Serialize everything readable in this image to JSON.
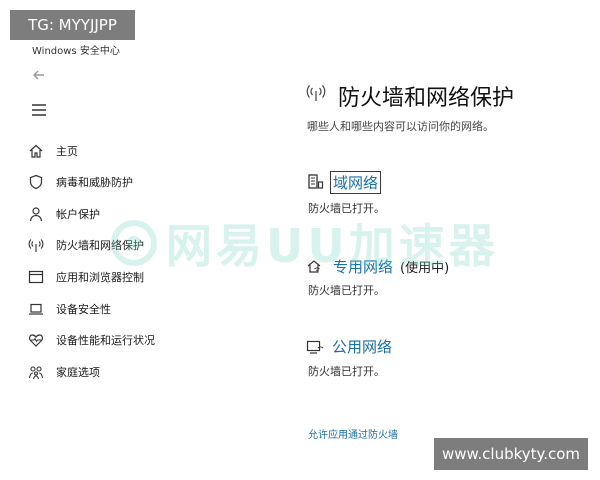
{
  "overlay": {
    "tg_badge": "TG: MYYJJPP",
    "site_badge": "www.clubkyty.com",
    "watermark_text": "网易UU加速器"
  },
  "window": {
    "title": "Windows 安全中心"
  },
  "sidebar": {
    "items": [
      {
        "label": "主页",
        "icon": "home-icon"
      },
      {
        "label": "病毒和威胁防护",
        "icon": "shield-icon"
      },
      {
        "label": "帐户保护",
        "icon": "person-icon"
      },
      {
        "label": "防火墙和网络保护",
        "icon": "wifi-antenna-icon"
      },
      {
        "label": "应用和浏览器控制",
        "icon": "app-window-icon"
      },
      {
        "label": "设备安全性",
        "icon": "laptop-icon"
      },
      {
        "label": "设备性能和运行状况",
        "icon": "heart-pulse-icon"
      },
      {
        "label": "家庭选项",
        "icon": "family-icon"
      }
    ]
  },
  "main": {
    "title": "防火墙和网络保护",
    "subtitle": "哪些人和哪些内容可以访问你的网络。",
    "networks": [
      {
        "name": "域网络",
        "status": "防火墙已打开。",
        "active": "",
        "icon": "domain-network-icon"
      },
      {
        "name": "专用网络",
        "status": "防火墙已打开。",
        "active": "(使用中)",
        "icon": "private-network-icon"
      },
      {
        "name": "公用网络",
        "status": "防火墙已打开。",
        "active": "",
        "icon": "public-network-icon"
      }
    ],
    "allow_app_link": "允许应用通过防火墙"
  },
  "colors": {
    "link": "#1a6fa8",
    "watermark": "#7fd6c8",
    "badge_bg": "#7d7d7d"
  }
}
